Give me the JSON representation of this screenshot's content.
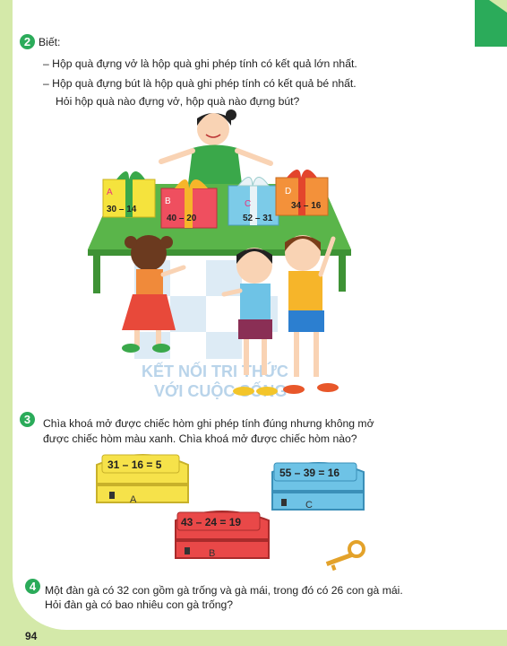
{
  "page_number": "94",
  "exercise2": {
    "number": "2",
    "intro": "Biết:",
    "line1": "–  Hộp quà đựng vở là hộp quà ghi phép tính có kết quả lớn nhất.",
    "line2": "–  Hộp quà đựng bút là hộp quà ghi phép tính có kết quả bé nhất.",
    "question": "Hỏi hộp quà nào đựng vở, hộp quà nào đựng bút?",
    "boxes": [
      {
        "letter": "A",
        "expr": "30 – 14",
        "color": "#f5e33d",
        "ribbon": "#3aa84a"
      },
      {
        "letter": "B",
        "expr": "40 – 20",
        "color": "#ef4f5f",
        "ribbon": "#f6b52a"
      },
      {
        "letter": "C",
        "expr": "52 – 31",
        "color": "#7ccbe8",
        "ribbon": "#e9f3f7"
      },
      {
        "letter": "D",
        "expr": "34 – 16",
        "color": "#f3913a",
        "ribbon": "#e3452c"
      }
    ],
    "watermark1": "KẾT NỐI TRI THỨC",
    "watermark2": "VỚI CUỘC SỐNG"
  },
  "exercise3": {
    "number": "3",
    "line1": "Chìa khoá mở được chiếc hòm ghi phép tính đúng nhưng không mở",
    "line2": "được chiếc hòm màu xanh. Chìa khoá mở được chiếc hòm nào?",
    "chests": [
      {
        "letter": "A",
        "expr": "31 – 16 = 5",
        "color": "#f6e24a"
      },
      {
        "letter": "B",
        "expr": "43 – 24 = 19",
        "color": "#e94848"
      },
      {
        "letter": "C",
        "expr": "55 – 39 = 16",
        "color": "#6ec3e6"
      }
    ]
  },
  "exercise4": {
    "number": "4",
    "line1": "Một đàn gà có 32 con gồm gà trống và gà mái, trong đó có 26 con gà mái.",
    "line2": "Hỏi đàn gà có bao nhiêu con gà trống?"
  }
}
